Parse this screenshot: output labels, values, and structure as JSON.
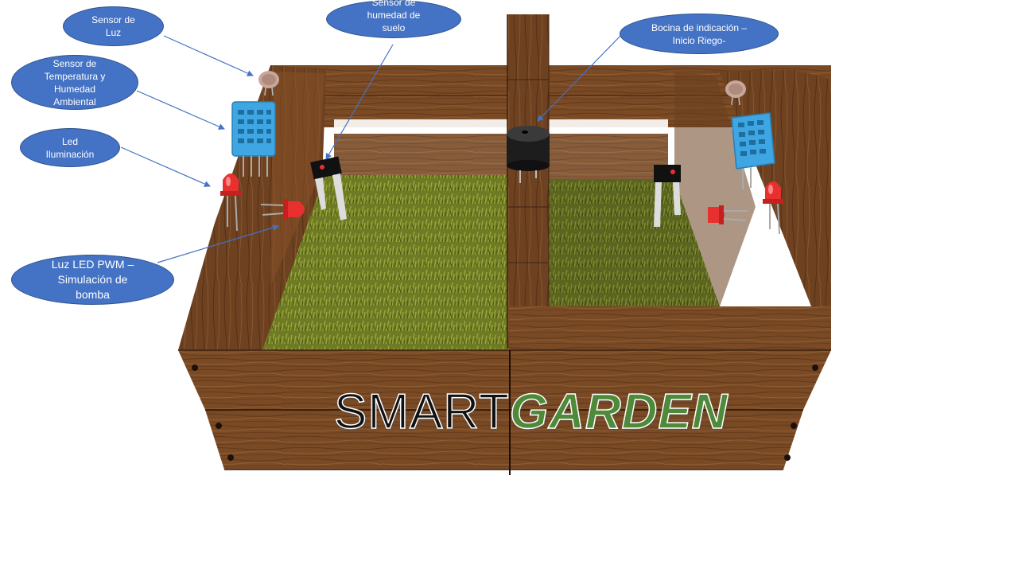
{
  "callouts": {
    "light_sensor": "Sensor de\nLuz",
    "temp_humidity_sensor": "Sensor de\nTemperatura y\nHumedad\nAmbiental",
    "led_lighting": "Led\nIluminación",
    "pwm_led": "Luz LED PWM –\nSimulación de\nbomba",
    "soil_moisture_sensor": "Sensor de\nhumedad de\nsuelo",
    "buzzer": "Bocina de indicación –\nInicio Riego-"
  },
  "brand": {
    "part1": "SMART",
    "part2": "GARDEN"
  },
  "colors": {
    "callout_fill": "#4472c4",
    "callout_border": "#2f528f",
    "wood": "#7a4a25",
    "grass": "#7d8a2a",
    "brand_green": "#4e8a3a"
  }
}
